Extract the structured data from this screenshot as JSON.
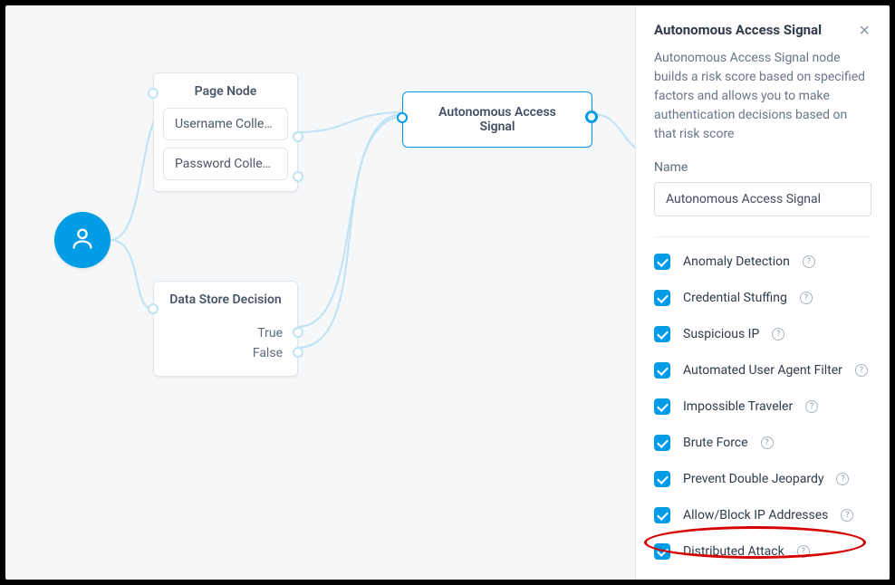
{
  "canvas": {
    "start_node_icon": "person-icon",
    "page_node": {
      "title": "Page Node",
      "slots": [
        "Username Colle…",
        "Password Collec…"
      ]
    },
    "data_store": {
      "title": "Data Store Decision",
      "outcomes": [
        "True",
        "False"
      ]
    },
    "target": {
      "title": "Autonomous Access Signal"
    }
  },
  "panel": {
    "title": "Autonomous Access Signal",
    "description": "Autonomous Access Signal node builds a risk score based on specified factors and allows you to make authentication decisions based on that risk score",
    "name_label": "Name",
    "name_value": "Autonomous Access Signal",
    "options": [
      "Anomaly Detection",
      "Credential Stuffing",
      "Suspicious IP",
      "Automated User Agent Filter",
      "Impossible Traveler",
      "Brute Force",
      "Prevent Double Jeopardy",
      "Allow/Block IP Addresses",
      "Distributed Attack"
    ]
  },
  "colors": {
    "accent": "#009ce5",
    "edge": "#bfe2f4",
    "annotation": "#d60000"
  }
}
